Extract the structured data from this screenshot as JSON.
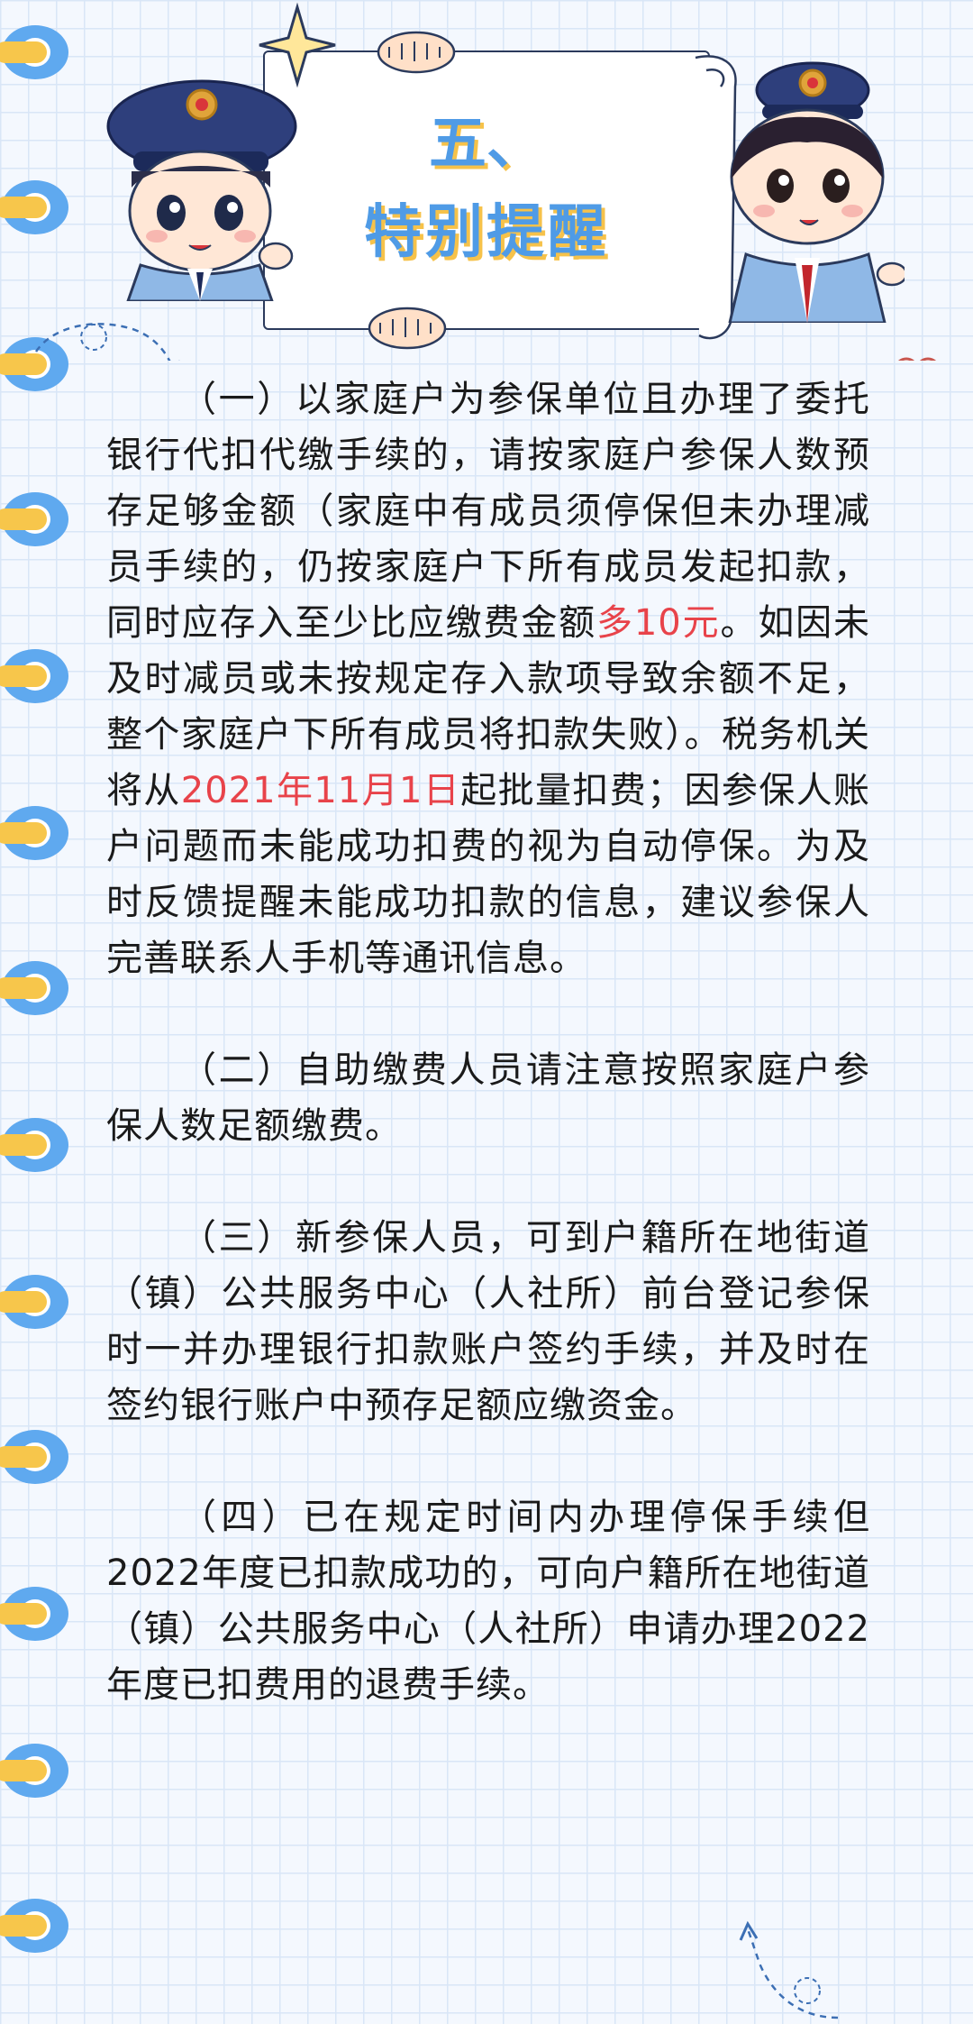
{
  "title": {
    "line1": "五、",
    "line2": "特别提醒"
  },
  "paragraphs": {
    "p1": {
      "a": "（一）以家庭户为参保单位且办理了委托银行代扣代缴手续的，请按家庭户参保人数预存足够金额（家庭中有成员须停保但未办理减员手续的，仍按家庭户下所有成员发起扣款，同时应存入至少比应缴费金额",
      "b": "多10元",
      "c": "。如因未及时减员或未按规定存入款项导致余额不足，整个家庭户下所有成员将扣款失败）。税务机关将从",
      "d": "2021年11月1日",
      "e": "起批量扣费；因参保人账户问题而未能成功扣费的视为自动停保。为及时反馈提醒未能成功扣款的信息，建议参保人完善联系人手机等通讯信息。"
    },
    "p2": "（二）自助缴费人员请注意按照家庭户参保人数足额缴费。",
    "p3": "（三）新参保人员，可到户籍所在地街道（镇）公共服务中心（人社所）前台登记参保时一并办理银行扣款账户签约手续，并及时在签约银行账户中预存足额应缴资金。",
    "p4": "（四）已在规定时间内办理停保手续但2022年度已扣款成功的，可向户籍所在地街道（镇）公共服务中心（人社所）申请办理2022年度已扣费用的退费手续。"
  },
  "colors": {
    "highlight": "#e8434a",
    "title": "#4f9be6",
    "title_shadow": "#f6c24a",
    "ring": "#5fa9ef",
    "ring_bar": "#f7c64b"
  },
  "icons": [
    "notebook-ring-icon",
    "male-officer-illustration",
    "female-officer-illustration",
    "sparkle-star-icon",
    "flower-icon",
    "dashed-arrow-icon"
  ]
}
